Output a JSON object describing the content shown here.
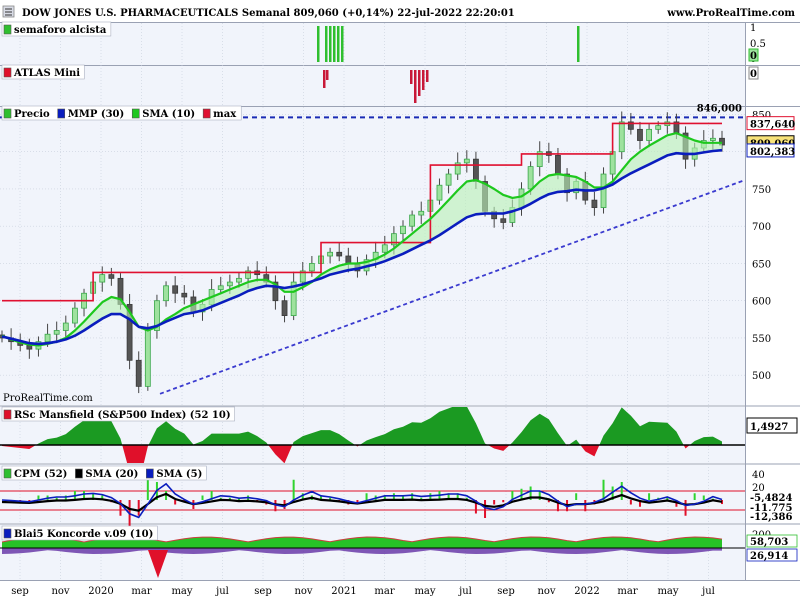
{
  "header": {
    "title": "DOW JONES U.S. PHARMACEUTICALS Semanal 809,060 (+0,14%) 22-jul-2022 22:20:01",
    "site": "www.ProRealTime.com"
  },
  "watermark": "ProRealTime.com",
  "colors": {
    "up": "#2fbf2f",
    "down": "#e0102a",
    "ema": "#0a1dbe",
    "sma10": "#1ec81e",
    "max": "#e01030",
    "trend": "#3a3acf",
    "pane_bg": "#f1f4fb",
    "grid": "#c9cfdc"
  },
  "panes": {
    "semaforo": {
      "legend": [
        {
          "label": "semaforo alcista",
          "color": "#2fbf2f"
        }
      ],
      "ticks": [
        "1",
        "0.5",
        "0"
      ],
      "readout": "0"
    },
    "atlas": {
      "legend": [
        {
          "label": "ATLAS Mini",
          "color": "#e0102a"
        }
      ],
      "ticks": [
        "0"
      ],
      "readout": "0"
    },
    "price": {
      "legend": [
        {
          "label": "Precio",
          "color": "#2fbf2f"
        },
        {
          "label": "MMP (30)",
          "color": "#0a1dbe"
        },
        {
          "label": "SMA (10)",
          "color": "#1ec81e"
        },
        {
          "label": "max",
          "color": "#e01030"
        }
      ],
      "ticks": [
        "500",
        "550",
        "600",
        "650",
        "700",
        "750",
        "800",
        "850"
      ],
      "line_label": "846,000",
      "badges": [
        {
          "text": "837,640",
          "color": "#e01030"
        },
        {
          "text": "809,060",
          "color": "#000000"
        },
        {
          "text": "802,383",
          "color": "#0a1dbe"
        }
      ]
    },
    "rsc": {
      "legend": [
        {
          "label": "RSc Mansfield (S&P500 Index) (52 10)",
          "color": "#e0102a"
        }
      ],
      "readout": "1,4927"
    },
    "cpm": {
      "legend": [
        {
          "label": "CPM (52)",
          "color": "#2fbf2f"
        },
        {
          "label": "SMA (20)",
          "color": "#000000"
        },
        {
          "label": "SMA (5)",
          "color": "#0a1dbe"
        }
      ],
      "ticks": [
        "40",
        "20"
      ],
      "readouts": [
        {
          "text": "-5,4824",
          "color": "#000000"
        },
        {
          "text": "-11,775",
          "color": "#e0102a"
        },
        {
          "text": "-12,386",
          "color": "#0a1dbe"
        }
      ]
    },
    "koncorde": {
      "legend": [
        {
          "label": "Blai5 Koncorde v.09 (10)",
          "color": "#0a1dbe"
        }
      ],
      "ticks": [
        "200"
      ],
      "readouts": [
        {
          "text": "58,703",
          "color": "#2fbf2f"
        },
        {
          "text": "26,914",
          "color": "#0a1dbe"
        }
      ]
    }
  },
  "chart_data": {
    "type": "line",
    "title": "DOW JONES U.S. PHARMACEUTICALS Semanal 809,060 (+0,14%) 22-jul-2022 22:20:01",
    "x_axis_labels": [
      "sep",
      "nov",
      "2020",
      "mar",
      "may",
      "jul",
      "sep",
      "nov",
      "2021",
      "mar",
      "may",
      "jul",
      "sep",
      "nov",
      "2022",
      "mar",
      "may",
      "jul"
    ],
    "ylim": [
      460,
      860
    ],
    "current_price": 809.06,
    "max_line_history": [
      {
        "from": "2019-08",
        "to": "2019-12",
        "value": 600
      },
      {
        "from": "2020-01",
        "to": "2020-12",
        "value": 638
      },
      {
        "from": "2021-01",
        "to": "2021-04",
        "value": 678
      },
      {
        "from": "2021-07",
        "to": "2021-12",
        "value": 782
      },
      {
        "from": "2022-01",
        "to": "2022-02",
        "value": 797
      },
      {
        "from": "2022-03",
        "to": "2022-07",
        "value": 838
      }
    ],
    "resistance_line": 846,
    "series": [
      {
        "name": "Precio",
        "values": [
          550,
          545,
          540,
          535,
          545,
          555,
          560,
          570,
          590,
          610,
          625,
          635,
          630,
          595,
          520,
          485,
          560,
          600,
          620,
          610,
          605,
          585,
          595,
          615,
          620,
          625,
          630,
          640,
          635,
          625,
          600,
          580,
          625,
          640,
          650,
          660,
          665,
          660,
          650,
          640,
          655,
          665,
          675,
          690,
          700,
          715,
          720,
          735,
          755,
          770,
          785,
          790,
          760,
          720,
          710,
          705,
          725,
          750,
          780,
          800,
          795,
          770,
          745,
          760,
          735,
          725,
          770,
          800,
          840,
          830,
          815,
          830,
          835,
          840,
          825,
          790,
          805,
          815,
          818,
          809
        ]
      },
      {
        "name": "MMP (30)",
        "values": [
          552,
          549,
          546,
          543,
          542,
          543,
          545,
          548,
          553,
          560,
          568,
          576,
          582,
          582,
          575,
          565,
          563,
          566,
          572,
          577,
          582,
          584,
          587,
          592,
          597,
          602,
          607,
          613,
          617,
          620,
          619,
          617,
          619,
          622,
          626,
          630,
          635,
          638,
          641,
          643,
          646,
          649,
          653,
          658,
          663,
          669,
          675,
          681,
          688,
          696,
          704,
          712,
          716,
          717,
          717,
          717,
          720,
          724,
          730,
          737,
          743,
          746,
          747,
          749,
          748,
          748,
          751,
          756,
          764,
          771,
          777,
          783,
          789,
          795,
          798,
          797,
          797,
          799,
          801,
          802
        ]
      },
      {
        "name": "SMA (10)",
        "values": [
          553,
          548,
          544,
          541,
          540,
          542,
          545,
          550,
          560,
          572,
          585,
          598,
          605,
          602,
          585,
          565,
          560,
          565,
          575,
          582,
          590,
          595,
          600,
          605,
          610,
          615,
          620,
          625,
          628,
          628,
          622,
          612,
          612,
          618,
          625,
          635,
          642,
          647,
          650,
          650,
          652,
          656,
          662,
          670,
          680,
          690,
          700,
          710,
          722,
          735,
          748,
          760,
          762,
          757,
          750,
          742,
          738,
          740,
          748,
          760,
          768,
          770,
          768,
          766,
          760,
          752,
          752,
          760,
          775,
          790,
          800,
          808,
          815,
          822,
          825,
          820,
          815,
          812,
          812,
          812
        ]
      },
      {
        "name": "max",
        "values": [
          600,
          600,
          600,
          600,
          600,
          600,
          600,
          600,
          600,
          600,
          600,
          638,
          638,
          638,
          638,
          638,
          638,
          638,
          638,
          638,
          638,
          638,
          638,
          638,
          638,
          638,
          638,
          638,
          638,
          638,
          638,
          638,
          638,
          638,
          638,
          638,
          678,
          678,
          678,
          678,
          678,
          678,
          678,
          678,
          678,
          678,
          678,
          678,
          782,
          782,
          782,
          782,
          782,
          782,
          782,
          782,
          782,
          782,
          797,
          797,
          797,
          797,
          797,
          797,
          797,
          797,
          797,
          797,
          838,
          838,
          838,
          838,
          838,
          838,
          838,
          838,
          838,
          838,
          838,
          838
        ]
      }
    ]
  }
}
